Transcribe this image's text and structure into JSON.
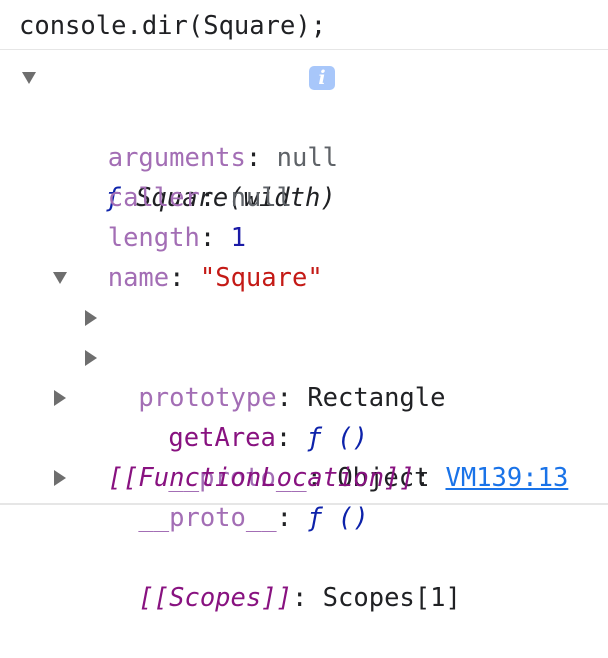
{
  "console": {
    "command": "console.dir(Square);"
  },
  "tree": {
    "root": {
      "f_symbol": "ƒ",
      "signature": "Square(width)",
      "info_badge": "i"
    },
    "arguments": {
      "key": "arguments",
      "sep": ": ",
      "value": "null"
    },
    "caller": {
      "key": "caller",
      "sep": ": ",
      "value": "null"
    },
    "length": {
      "key": "length",
      "sep": ": ",
      "value": "1"
    },
    "name": {
      "key": "name",
      "sep": ": ",
      "value": "\"Square\""
    },
    "prototype": {
      "key": "prototype",
      "sep": ": ",
      "value": "Rectangle"
    },
    "getArea": {
      "key": "getArea",
      "sep": ": ",
      "value": "ƒ ()"
    },
    "proto_inner": {
      "key": "__proto__",
      "sep": ": ",
      "value": "Object"
    },
    "proto_outer": {
      "key": "__proto__",
      "sep": ": ",
      "value": "ƒ ()"
    },
    "function_location": {
      "key": "[[FunctionLocation]]",
      "sep": ": ",
      "value": "VM139:13"
    },
    "scopes": {
      "key": "[[Scopes]]",
      "sep": ": ",
      "value": "Scopes[1]"
    }
  },
  "colors": {
    "function_symbol": "#0d22aa",
    "key_muted": "#a36eb5",
    "key_strong": "#881280",
    "number": "#1a1aa6",
    "string": "#c41a16",
    "link": "#1a73e8",
    "info_badge": "#a8c7fa"
  },
  "icons": {
    "expanded": "triangle-down-icon",
    "collapsed": "triangle-right-icon",
    "info": "info-icon"
  }
}
